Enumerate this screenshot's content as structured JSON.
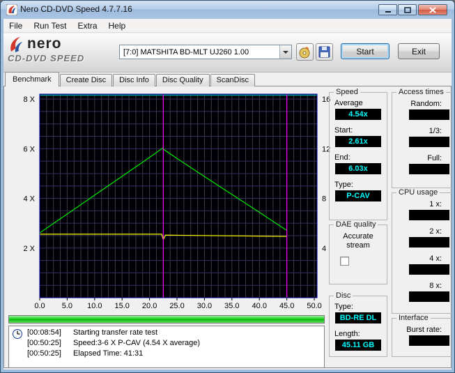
{
  "window": {
    "title": "Nero CD-DVD Speed 4.7.7.16"
  },
  "menu": {
    "items": [
      "File",
      "Run Test",
      "Extra",
      "Help"
    ]
  },
  "toolbar": {
    "logo_brand": "nero",
    "logo_product": "CD-DVD SPEED",
    "drive_selected": "[7:0] MATSHITA BD-MLT UJ260 1.00",
    "start_label": "Start",
    "exit_label": "Exit"
  },
  "tabs": {
    "items": [
      "Benchmark",
      "Create Disc",
      "Disc Info",
      "Disc Quality",
      "ScanDisc"
    ],
    "selected_index": 0
  },
  "chart_data": {
    "type": "line",
    "title": "",
    "xlabel": "",
    "ylabel": "",
    "xlim": [
      0,
      50.5
    ],
    "ylim": [
      0,
      8.2
    ],
    "x_ticks": [
      0,
      5,
      10,
      15,
      20,
      25,
      30,
      35,
      40,
      45,
      50
    ],
    "x_tick_labels": [
      "0.0",
      "5.0",
      "10.0",
      "15.0",
      "20.0",
      "25.0",
      "30.0",
      "35.0",
      "40.0",
      "45.0",
      "50.0"
    ],
    "y_ticks_left": [
      {
        "value": 2,
        "label": "2 X"
      },
      {
        "value": 4,
        "label": "4 X"
      },
      {
        "value": 6,
        "label": "6 X"
      },
      {
        "value": 8,
        "label": "8 X"
      }
    ],
    "y_ticks_right": [
      {
        "value": 2,
        "label": "4"
      },
      {
        "value": 4,
        "label": "8"
      },
      {
        "value": 6,
        "label": "12"
      },
      {
        "value": 8,
        "label": "16"
      }
    ],
    "grid": {
      "x_step": 1.25,
      "y_step": 0.5
    },
    "series": [
      {
        "name": "read-speed",
        "color": "#00ee00",
        "points": [
          [
            0,
            2.61
          ],
          [
            5,
            3.37
          ],
          [
            10,
            4.13
          ],
          [
            15,
            4.89
          ],
          [
            20,
            5.65
          ],
          [
            22.4,
            6.03
          ],
          [
            22.6,
            5.97
          ],
          [
            25,
            5.61
          ],
          [
            30,
            4.88
          ],
          [
            35,
            4.16
          ],
          [
            40,
            3.44
          ],
          [
            44.5,
            2.78
          ],
          [
            45,
            2.72
          ]
        ]
      },
      {
        "name": "rotation-speed",
        "color": "#ffff00",
        "points": [
          [
            0,
            2.56
          ],
          [
            22.2,
            2.56
          ],
          [
            22.5,
            2.34
          ],
          [
            22.9,
            2.52
          ],
          [
            45,
            2.47
          ]
        ]
      }
    ],
    "vlines": [
      {
        "x": 22.5,
        "color": "#ff00ff"
      },
      {
        "x": 45,
        "color": "#ff00ff"
      }
    ],
    "legend_position": "none",
    "colors": {
      "plot_bg": "#000006",
      "plot_border": "#0000a0",
      "grid_x": "#3d3d3d",
      "grid_y": "#32325e",
      "top_line": "#009898"
    }
  },
  "panels": {
    "speed": {
      "title": "Speed",
      "fields": [
        {
          "label": "Average",
          "value": "4.54x"
        },
        {
          "label": "Start:",
          "value": "2.61x"
        },
        {
          "label": "End:",
          "value": "6.03x"
        },
        {
          "label": "Type:",
          "value": "P-CAV"
        }
      ]
    },
    "dae": {
      "title": "DAE quality",
      "checkbox_label": "Accurate stream",
      "checked": false
    },
    "disc": {
      "title": "Disc",
      "fields": [
        {
          "label": "Type:",
          "value": "BD-RE DL"
        },
        {
          "label": "Length:",
          "value": "45.11 GB"
        }
      ]
    },
    "access": {
      "title": "Access times",
      "fields": [
        {
          "label": "Random:",
          "value": ""
        },
        {
          "label": "1/3:",
          "value": ""
        },
        {
          "label": "Full:",
          "value": ""
        }
      ]
    },
    "cpu": {
      "title": "CPU usage",
      "fields": [
        {
          "label": "1 x:",
          "value": ""
        },
        {
          "label": "2 x:",
          "value": ""
        },
        {
          "label": "4 x:",
          "value": ""
        },
        {
          "label": "8 x:",
          "value": ""
        }
      ]
    },
    "interface": {
      "title": "Interface",
      "fields": [
        {
          "label": "Burst rate:",
          "value": ""
        }
      ]
    }
  },
  "progress": {
    "percent": 100
  },
  "log": {
    "entries": [
      {
        "time": "[00:08:54]",
        "text": "Starting transfer rate test"
      },
      {
        "time": "[00:50:25]",
        "text": "Speed:3-6 X P-CAV (4.54 X average)"
      },
      {
        "time": "[00:50:25]",
        "text": "Elapsed Time: 41:31"
      }
    ]
  }
}
